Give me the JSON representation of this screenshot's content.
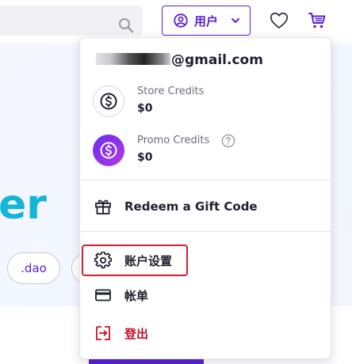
{
  "header": {
    "search": {
      "value": "",
      "placeholder": ""
    },
    "user_menu_label": "用户"
  },
  "page": {
    "hero_word_partial": "er",
    "chips": [
      ".dao"
    ]
  },
  "menu": {
    "email_suffix": "@gmail.com",
    "credits": [
      {
        "label": "Store Credits",
        "value": "$0",
        "icon": "dollar-coin-icon"
      },
      {
        "label": "Promo Credits",
        "value": "$0",
        "icon": "dollar-coin-icon"
      }
    ],
    "items": [
      {
        "label": "Redeem a Gift Code",
        "icon": "gift-icon"
      },
      {
        "label": "账户设置",
        "icon": "gear-icon"
      },
      {
        "label": "帐单",
        "icon": "credit-card-icon"
      },
      {
        "label": "登出",
        "icon": "logout-icon"
      }
    ]
  },
  "colors": {
    "brand_purple": "#5b21d1",
    "hero_cyan": "#16b4d8",
    "logout_red": "#c8102e",
    "highlight_red": "#d21f2f"
  }
}
